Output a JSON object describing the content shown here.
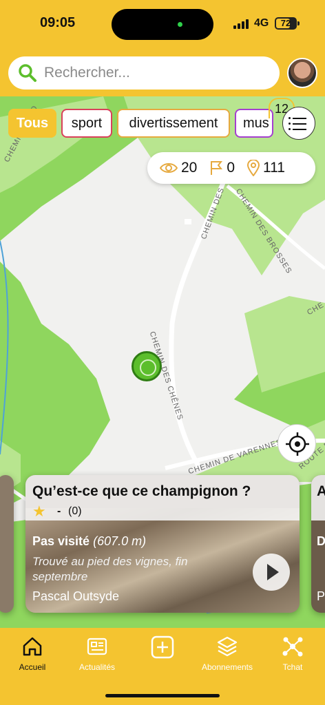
{
  "status_bar": {
    "time": "09:05",
    "network": "4G",
    "battery": "72",
    "battery_level": 0.72
  },
  "search": {
    "placeholder": "Rechercher..."
  },
  "filters": {
    "all": "Tous",
    "chips": [
      "sport",
      "divertissement",
      "mus"
    ],
    "colors": {
      "all": "#f4c430",
      "sport": "#d9405b",
      "divertissement": "#e6a93e",
      "mus": "#a43fd0"
    },
    "cluster_count": "12"
  },
  "stats": {
    "views": "20",
    "flags": "0",
    "places": "111"
  },
  "streets": {
    "chemin_des_chenes": "CHEMIN DES CHÊNES",
    "chemin_des_brosses": "CHEMIN DES BROSSES",
    "chemin_des": "CHEMIN DES",
    "chemin_de_varennes": "CHEMIN DE VARENNES",
    "chemin_du_jo": "CHEMIN DU JO",
    "route_de": "ROUTE DE",
    "che": "CHE"
  },
  "card": {
    "title": "Qu’est-ce que ce champignon ?",
    "rating": "-",
    "rating_count": "(0)",
    "visit_status": "Pas visité",
    "distance": "(607.0 m)",
    "description": "Trouvé au pied des vignes, fin septembre",
    "author": "Pascal Outsyde"
  },
  "next_card": {
    "title_initial": "A",
    "status_initial": "D",
    "author_initial": "P"
  },
  "tabbar": [
    {
      "label": "Accueil",
      "icon": "home-icon",
      "active": true
    },
    {
      "label": "Actualités",
      "icon": "newspaper-icon",
      "active": false
    },
    {
      "label": "",
      "icon": "plus-square-icon",
      "active": false
    },
    {
      "label": "Abonnements",
      "icon": "layers-icon",
      "active": false
    },
    {
      "label": "Tchat",
      "icon": "network-icon",
      "active": false
    }
  ],
  "colors": {
    "brand": "#f4c430",
    "map_green": "#8fd65e",
    "map_green_light": "#b8e58f"
  }
}
